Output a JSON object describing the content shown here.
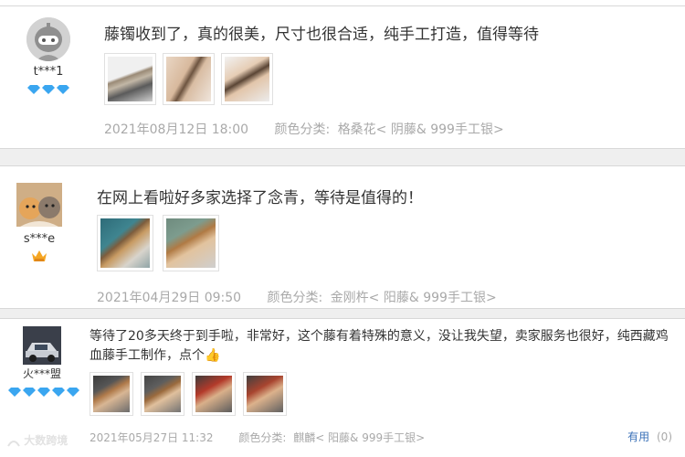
{
  "reviews": [
    {
      "username": "t***1",
      "text": "藤镯收到了，真的很美，尺寸也很合适，纯手工打造，值得等待",
      "date": "2021年08月12日 18:00",
      "color_label": "颜色分类:",
      "color_value": "格桑花< 阴藤& 999手工银>",
      "badge": "diamond",
      "badge_count": 3
    },
    {
      "username": "s***e",
      "text": "在网上看啦好多家选择了念青，等待是值得的！",
      "date": "2021年04月29日 09:50",
      "color_label": "颜色分类:",
      "color_value": "金刚杵< 阳藤& 999手工银>",
      "badge": "crown",
      "badge_count": 1
    },
    {
      "username": "火***盟",
      "text": "等待了20多天终于到手啦，非常好，这个藤有着特殊的意义，没让我失望，卖家服务也很好，纯西藏鸡血藤手工制作，点个👍",
      "date": "2021年05月27日 11:32",
      "color_label": "颜色分类:",
      "color_value": "麒麟< 阳藤& 999手工银>",
      "badge": "diamond",
      "badge_count": 5
    }
  ],
  "useful": {
    "label": "有用",
    "count": "(0)"
  },
  "watermark": "大数跨境",
  "colors": {
    "divider": "#d8d8d8",
    "meta_text": "#a9a9a9",
    "badge_diamond": "#3aa6f0",
    "badge_crown": "#f5a623",
    "useful_link": "#3b72b8"
  }
}
